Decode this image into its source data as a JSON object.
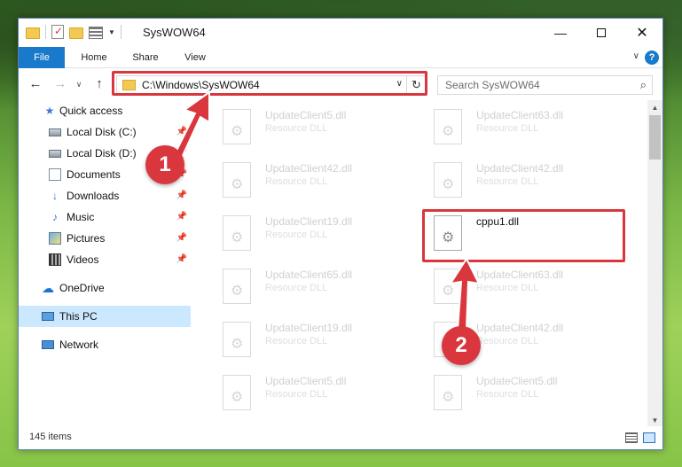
{
  "window": {
    "title": "SysWOW64"
  },
  "ribbon": {
    "tabs": [
      "File",
      "Home",
      "Share",
      "View"
    ]
  },
  "nav": {
    "address": "C:\\Windows\\SysWOW64",
    "search_placeholder": "Search SysWOW64"
  },
  "sidebar": {
    "items": [
      {
        "label": "Quick access",
        "icon": "star-icon"
      },
      {
        "label": "Local Disk (C:)",
        "icon": "disk-icon",
        "pinned": true
      },
      {
        "label": "Local Disk (D:)",
        "icon": "disk-icon",
        "pinned": true
      },
      {
        "label": "Documents",
        "icon": "documents-icon",
        "pinned": true
      },
      {
        "label": "Downloads",
        "icon": "download-icon",
        "pinned": true
      },
      {
        "label": "Music",
        "icon": "music-icon",
        "pinned": true
      },
      {
        "label": "Pictures",
        "icon": "pictures-icon",
        "pinned": true
      },
      {
        "label": "Videos",
        "icon": "videos-icon",
        "pinned": true
      },
      {
        "label": "OneDrive",
        "icon": "onedrive-icon"
      },
      {
        "label": "This PC",
        "icon": "pc-icon",
        "selected": true
      },
      {
        "label": "Network",
        "icon": "network-icon"
      }
    ]
  },
  "files": [
    {
      "name": "UpdateClient5.dll",
      "type": "Resource DLL"
    },
    {
      "name": "UpdateClient63.dll",
      "type": "Resource DLL"
    },
    {
      "name": "UpdateClient42.dll",
      "type": "Resource DLL"
    },
    {
      "name": "UpdateClient42.dll",
      "type": "Resource DLL"
    },
    {
      "name": "UpdateClient19.dll",
      "type": "Resource DLL"
    },
    {
      "name": "cppu1.dll",
      "type": ""
    },
    {
      "name": "UpdateClient65.dll",
      "type": "Resource DLL"
    },
    {
      "name": "UpdateClient63.dll",
      "type": "Resource DLL"
    },
    {
      "name": "UpdateClient19.dll",
      "type": "Resource DLL"
    },
    {
      "name": "UpdateClient42.dll",
      "type": "Resource DLL"
    },
    {
      "name": "UpdateClient5.dll",
      "type": "Resource DLL"
    },
    {
      "name": "UpdateClient5.dll",
      "type": "Resource DLL"
    }
  ],
  "status": {
    "items_count": "145 items"
  },
  "annotations": {
    "step1": "1",
    "step2": "2",
    "color": "#d9363e"
  }
}
